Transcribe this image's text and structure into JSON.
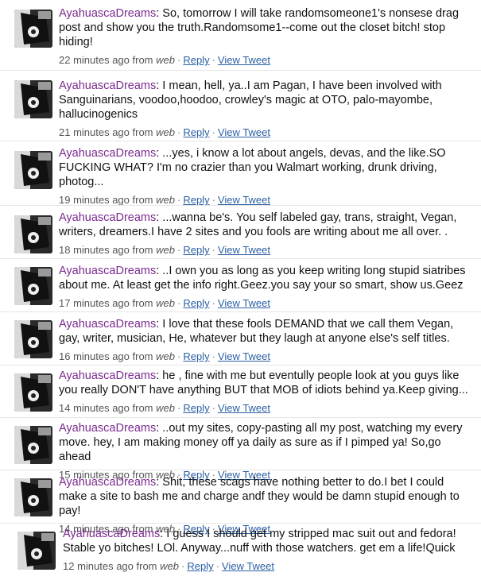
{
  "tweets": [
    {
      "author": "AyahuascaDreams",
      "text": ": So, tomorrow I will take randomsomeone1's nonsese drag post and show you the truth.Randomsome1--come out the closet bitch! stop hiding!",
      "time": "22 minutes ago from",
      "source": "web",
      "reply": "Reply",
      "view": "View Tweet"
    },
    {
      "author": "AyahuascaDreams",
      "text": ": I mean, hell, ya..I am Pagan, I have been involved with Sanguinarians, voodoo,hoodoo, crowley's magic at OTO, palo-mayombe, hallucinogenics",
      "time": "21 minutes ago from",
      "source": "web",
      "reply": "Reply",
      "view": "View Tweet"
    },
    {
      "author": "AyahuascaDreams",
      "text": ": ...yes, i know a lot about angels, devas, and the like.SO FUCKING WHAT? I'm no crazier than you Walmart working, drunk driving, photog...",
      "time": "19 minutes ago from",
      "source": "web",
      "reply": "Reply",
      "view": "View Tweet"
    },
    {
      "author": "AyahuascaDreams",
      "text": ": ...wanna be's. You self labeled gay, trans, straight, Vegan, writers, dreamers.I have 2 sites and you fools are writing about me all over. .",
      "time": "18 minutes ago from",
      "source": "web",
      "reply": "Reply",
      "view": "View Tweet"
    },
    {
      "author": "AyahuascaDreams",
      "text": ": ..I own you as long as you keep writing long stupid siatribes about me. At least get the info right.Geez.you say your so smart, show us.Geez",
      "time": "17 minutes ago from",
      "source": "web",
      "reply": "Reply",
      "view": "View Tweet"
    },
    {
      "author": "AyahuascaDreams",
      "text": ": I love that these fools DEMAND that we call them Vegan, gay, writer, musician, He, whatever but they laugh at anyone else's self titles.",
      "time": "16 minutes ago from",
      "source": "web",
      "reply": "Reply",
      "view": "View Tweet"
    },
    {
      "author": "AyahuascaDreams",
      "text": ": he , fine with me but eventully people look at you guys like you really DON'T have anything BUT that MOB of idiots behind ya.Keep giving...",
      "time": "14 minutes ago from",
      "source": "web",
      "reply": "Reply",
      "view": "View Tweet"
    },
    {
      "author": "AyahuascaDreams",
      "text": ": ..out my sites, copy-pasting all my post, watching my every move. hey, I am making money off ya daily as sure as if I pimped ya! So,go ahead",
      "time": "15 minutes ago from",
      "source": "web",
      "reply": "Reply",
      "view": "View Tweet"
    },
    {
      "author": "AyahuascaDreams",
      "text": ": Shit, these scags have nothing better to do.I bet I could make a site to bash me and charge andf they would be damn stupid enough to pay!",
      "time": "14 minutes ago from",
      "source": "web",
      "reply": "Reply",
      "view": "View Tweet"
    },
    {
      "author": "AyahuascaDreams",
      "text": ": I guess I should get my stripped mac suit out and fedora! Stable yo bitches! LOl. Anyway...nuff with those watchers. get em a life!Quick",
      "time": "12 minutes ago from",
      "source": "web",
      "reply": "Reply",
      "view": "View Tweet"
    }
  ],
  "icons": {
    "avatar": "user-avatar-photo"
  },
  "colors": {
    "author": "#7b2a8e",
    "link": "#2b5fa3",
    "meta": "#555555"
  }
}
